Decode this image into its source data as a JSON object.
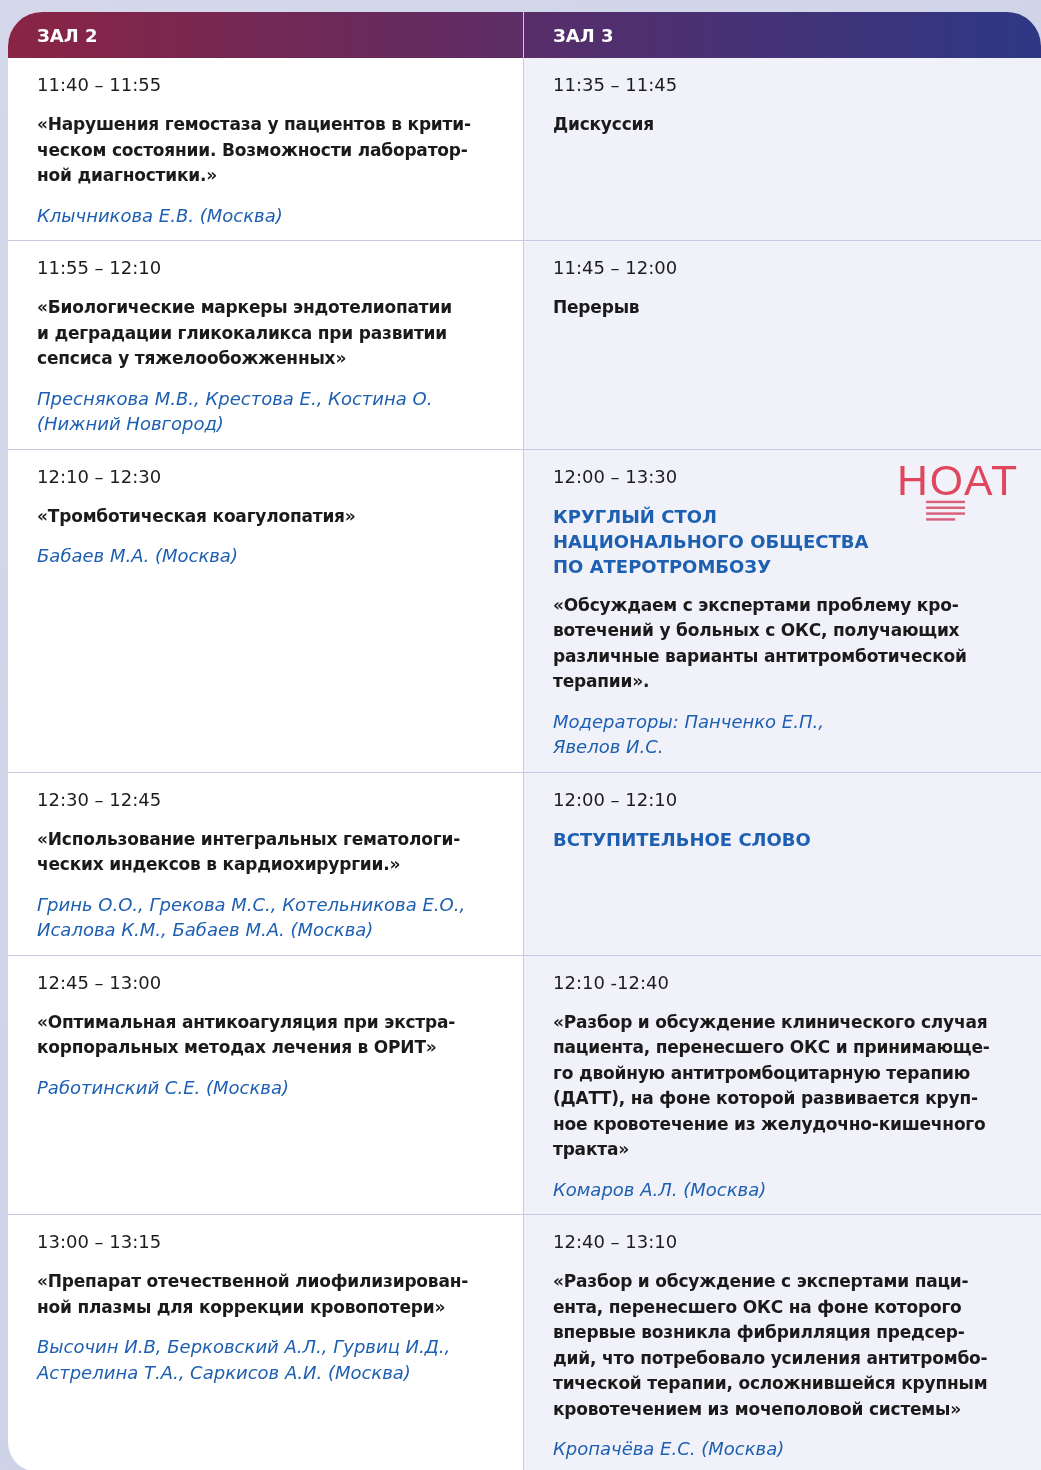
{
  "halls": [
    "ЗАЛ 2",
    "ЗАЛ 3"
  ],
  "rows": [
    {
      "cells": [
        {
          "time": "11:40 – 11:55",
          "title": "«Нарушения гемостаза у пациентов в крити-\nческом состоянии. Возможности лаборатор-\nной диагностики.»",
          "authors": "Клычникова Е.В.  (Москва)"
        },
        {
          "time": "11:35 – 11:45",
          "title": "Дискуссия"
        }
      ]
    },
    {
      "cells": [
        {
          "time": "11:55 – 12:10",
          "title": "«Биологические маркеры эндотелиопатии\nи деградации гликокаликса при развитии\nсепсиса у тяжелообожженных»",
          "authors": "Преснякова М.В., Крестова Е., Костина О.\n(Нижний Новгород)"
        },
        {
          "time": "11:45 – 12:00",
          "title": "Перерыв"
        }
      ]
    },
    {
      "cells": [
        {
          "time": "12:10 – 12:30",
          "title": "«Тромботическая коагулопатия»",
          "authors": "Бабаев М.А. (Москва)"
        },
        {
          "time": "12:00 – 13:30",
          "logo": "НОАТ",
          "heading": "КРУГЛЫЙ СТОЛ\nНАЦИОНАЛЬНОГО ОБЩЕСТВА\nПО АТЕРОТРОМБОЗУ",
          "title": "«Обсуждаем с экспертами проблему кро-\nвотечений у больных с ОКС, получающих\nразличные варианты антитромботической\nтерапии».",
          "authors": "Модераторы: Панченко Е.П.,\nЯвелов И.С."
        }
      ]
    },
    {
      "cells": [
        {
          "time": "12:30 – 12:45",
          "title": "«Использование интегральных гематологи-\nческих индексов в кардиохирургии.»",
          "authors": "Гринь О.О., Грекова М.С., Котельникова Е.О.,\nИсалова К.М., Бабаев М.А. (Москва)"
        },
        {
          "time": "12:00 – 12:10",
          "heading": "ВСТУПИТЕЛЬНОЕ СЛОВО"
        }
      ]
    },
    {
      "cells": [
        {
          "time": "12:45 – 13:00",
          "title": "«Оптимальная антикоагуляция при экстра-\nкорпоральных методах лечения в ОРИТ»",
          "authors": "Работинский С.Е. (Москва)"
        },
        {
          "time": "12:10 -12:40",
          "title": "«Разбор и обсуждение клинического случая\nпациента, перенесшего ОКС и принимающе-\nго двойную антитромбоцитарную терапию\n(ДАТТ), на фоне которой развивается круп-\nное кровотечение из желудочно-кишечного\nтракта»",
          "authors": "Комаров А.Л. (Москва)"
        }
      ]
    },
    {
      "cells": [
        {
          "time": "13:00 – 13:15",
          "title": "«Препарат отечественной лиофилизирован-\nной плазмы для коррекции кровопотери»",
          "authors": "Высочин И.В, Берковский А.Л., Гурвиц И.Д.,\nАстрелина Т.А., Саркисов А.И. (Москва)"
        },
        {
          "time": "12:40 – 13:10",
          "title": "«Разбор и обсуждение с экспертами паци-\nента, перенесшего ОКС на фоне которого\nвпервые возникла фибрилляция предсер-\nдий, что потребовало усиления антитромбо-\nтической терапии, осложнившейся крупным\nкровотечением из   мочеполовой системы»",
          "authors": "Кропачёва Е.С. (Москва)"
        }
      ]
    }
  ]
}
